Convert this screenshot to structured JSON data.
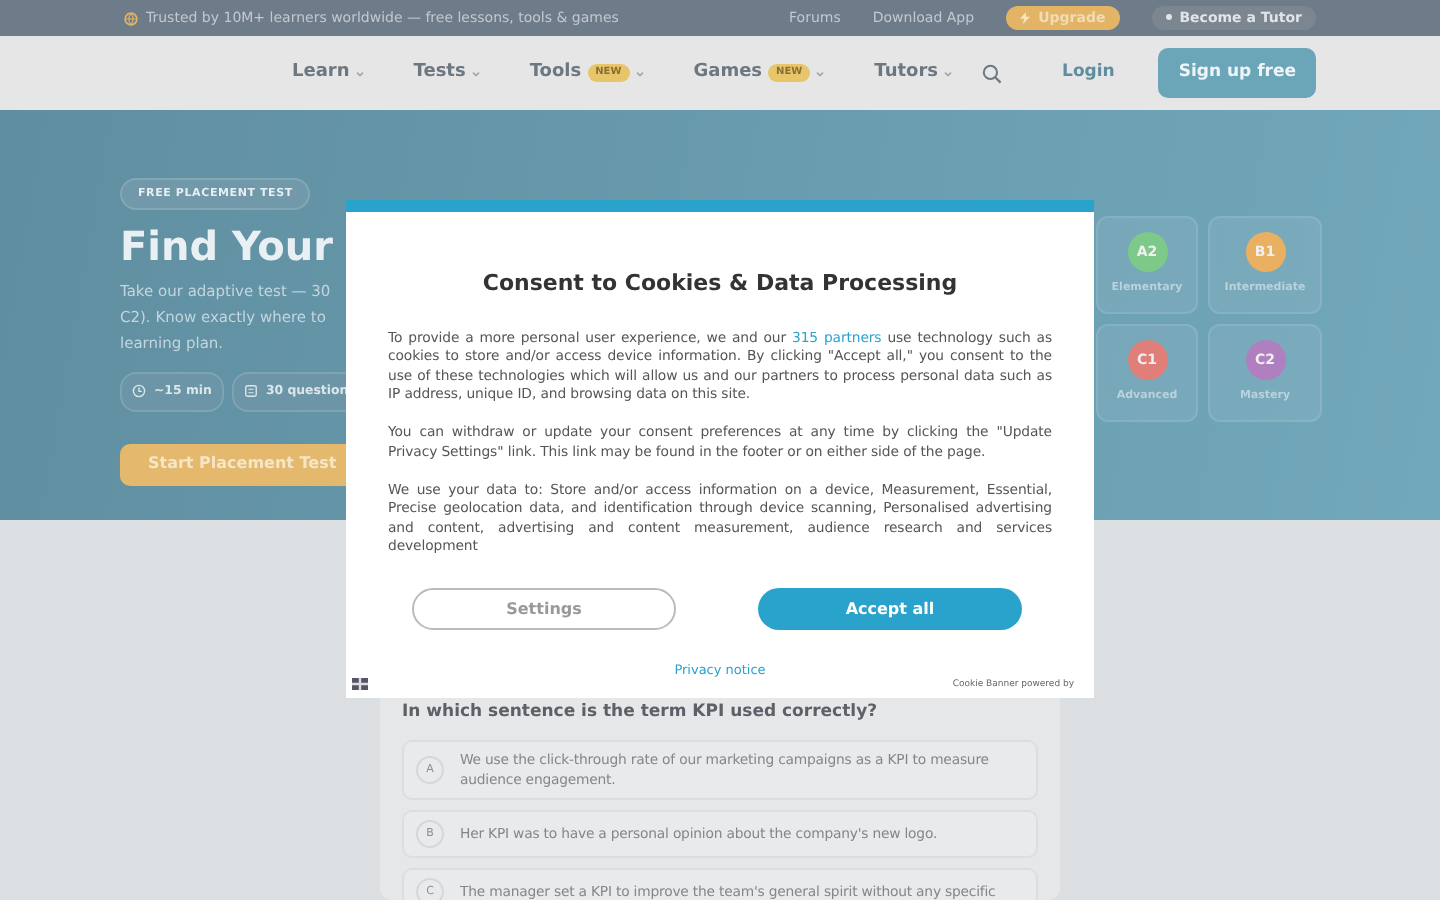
{
  "top_bar": {
    "tagline": "Trusted by 10M+ learners worldwide — free lessons, tools & games",
    "links": [
      "Forums",
      "Download App"
    ],
    "upgrade": "Upgrade",
    "become_tutor": "Become a Tutor"
  },
  "nav": {
    "items": [
      {
        "label": "Learn"
      },
      {
        "label": "Tests"
      },
      {
        "label": "Tools",
        "badge": "NEW"
      },
      {
        "label": "Games",
        "badge": "NEW"
      },
      {
        "label": "Tutors"
      }
    ],
    "login": "Login",
    "signup": "Sign up free"
  },
  "hero": {
    "badge": "FREE PLACEMENT TEST",
    "title": "Find Your",
    "description_lines": [
      "Take our adaptive test — 30",
      "C2). Know exactly where to",
      "learning plan."
    ],
    "chips": [
      "~15 min",
      "30 question"
    ],
    "cta": "Start Placement Test"
  },
  "levels": [
    {
      "code": "A2",
      "label": "Elementary",
      "color": "#7cc98a"
    },
    {
      "code": "B1",
      "label": "Intermediate",
      "color": "#e8b060"
    },
    {
      "code": "C1",
      "label": "Advanced",
      "color": "#e07f7a"
    },
    {
      "code": "C2",
      "label": "Mastery",
      "color": "#b07fc0"
    }
  ],
  "consent": {
    "title": "Consent to Cookies & Data Processing",
    "paragraphs": [
      {
        "text": "To provide a more personal user experience, we and our ",
        "link": "315 partners",
        "after": " use technology such as cookies to store and/or access device information. By clicking \"Accept all,\" you consent to the use of these technologies which will allow us and our partners to process personal data such as IP address, unique ID, and browsing data on this site."
      },
      {
        "text": "You can withdraw or update your consent preferences at any time by clicking the \"Update Privacy Settings\" link. This link may be found in the footer or on either side of the page."
      },
      {
        "text": "We use your data to: Store and/or access information on a device, Measurement, Essential, Precise geolocation data, and identification through device scanning, Personalised advertising and content, advertising and content measurement, audience research and services development"
      }
    ],
    "settings": "Settings",
    "accept": "Accept all",
    "privacy": "Privacy notice",
    "powered": "Cookie Banner powered by"
  },
  "question": {
    "text": "In which sentence is the term KPI used correctly?",
    "options": [
      {
        "letter": "A",
        "text": "We use the click-through rate of our marketing campaigns as a KPI to measure audience engagement."
      },
      {
        "letter": "B",
        "text": "Her KPI was to have a personal opinion about the company's new logo."
      },
      {
        "letter": "C",
        "text": "The manager set a KPI to improve the team's general spirit without any specific"
      }
    ]
  }
}
